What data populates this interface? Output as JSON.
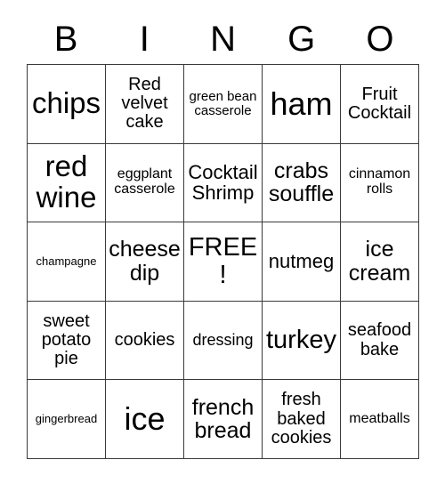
{
  "card": {
    "header": {
      "letters": [
        "B",
        "I",
        "N",
        "G",
        "O"
      ]
    },
    "columns": [
      "B",
      "I",
      "N",
      "G",
      "O"
    ],
    "free_space": "FREE!",
    "rows": [
      [
        {
          "text": "chips",
          "size": "fs-xxl"
        },
        {
          "text": "Red velvet cake",
          "size": "fs-m"
        },
        {
          "text": "green bean casserole",
          "size": "fs-xs"
        },
        {
          "text": "ham",
          "size": "fs-huge"
        },
        {
          "text": "Fruit Cocktail",
          "size": "fs-m"
        }
      ],
      [
        {
          "text": "red wine",
          "size": "fs-xxl"
        },
        {
          "text": "eggplant casserole",
          "size": "fs-s"
        },
        {
          "text": "Cocktail Shrimp",
          "size": "fs-ml"
        },
        {
          "text": "crabs souffle",
          "size": "fs-l"
        },
        {
          "text": "cinnamon rolls",
          "size": "fs-s"
        }
      ],
      [
        {
          "text": "champagne",
          "size": "fs-xxs"
        },
        {
          "text": "cheese dip",
          "size": "fs-l"
        },
        {
          "text": "FREE!",
          "size": "fs-xl"
        },
        {
          "text": "nutmeg",
          "size": "fs-ml"
        },
        {
          "text": "ice cream",
          "size": "fs-l"
        }
      ],
      [
        {
          "text": "sweet potato pie",
          "size": "fs-m"
        },
        {
          "text": "cookies",
          "size": "fs-m"
        },
        {
          "text": "dressing",
          "size": "fs-sm"
        },
        {
          "text": "turkey",
          "size": "fs-xl"
        },
        {
          "text": "seafood bake",
          "size": "fs-m"
        }
      ],
      [
        {
          "text": "gingerbread",
          "size": "fs-xxs"
        },
        {
          "text": "ice",
          "size": "fs-huge"
        },
        {
          "text": "french bread",
          "size": "fs-l"
        },
        {
          "text": "fresh baked cookies",
          "size": "fs-m"
        },
        {
          "text": "meatballs",
          "size": "fs-s"
        }
      ]
    ]
  },
  "colors": {
    "background": "#ffffff",
    "border": "#3a3a3a",
    "text": "#000000"
  }
}
